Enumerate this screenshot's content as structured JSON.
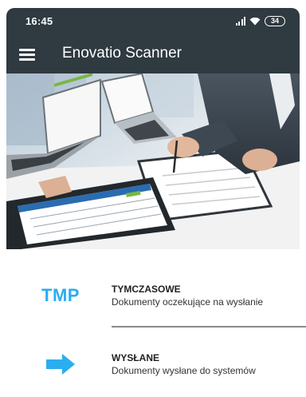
{
  "status_bar": {
    "time": "16:45",
    "battery": "34",
    "icons": [
      "signal-icon",
      "wifi-icon",
      "battery-icon"
    ]
  },
  "app_bar": {
    "title": "Enovatio Scanner",
    "menu_icon": "hamburger-menu-icon"
  },
  "hero": {
    "description_icon": "office-laptops-tablet-image"
  },
  "menu": {
    "items": [
      {
        "icon_text": "TMP",
        "title": "TYMCZASOWE",
        "subtitle": "Dokumenty oczekujące na wysłanie"
      },
      {
        "icon": "arrow-right-icon",
        "title": "WYSŁANE",
        "subtitle": "Dokumenty wysłane do systemów"
      }
    ]
  },
  "colors": {
    "app_bar": "#2f3a41",
    "accent_blue": "#29aef0",
    "text_dark": "#222222"
  }
}
